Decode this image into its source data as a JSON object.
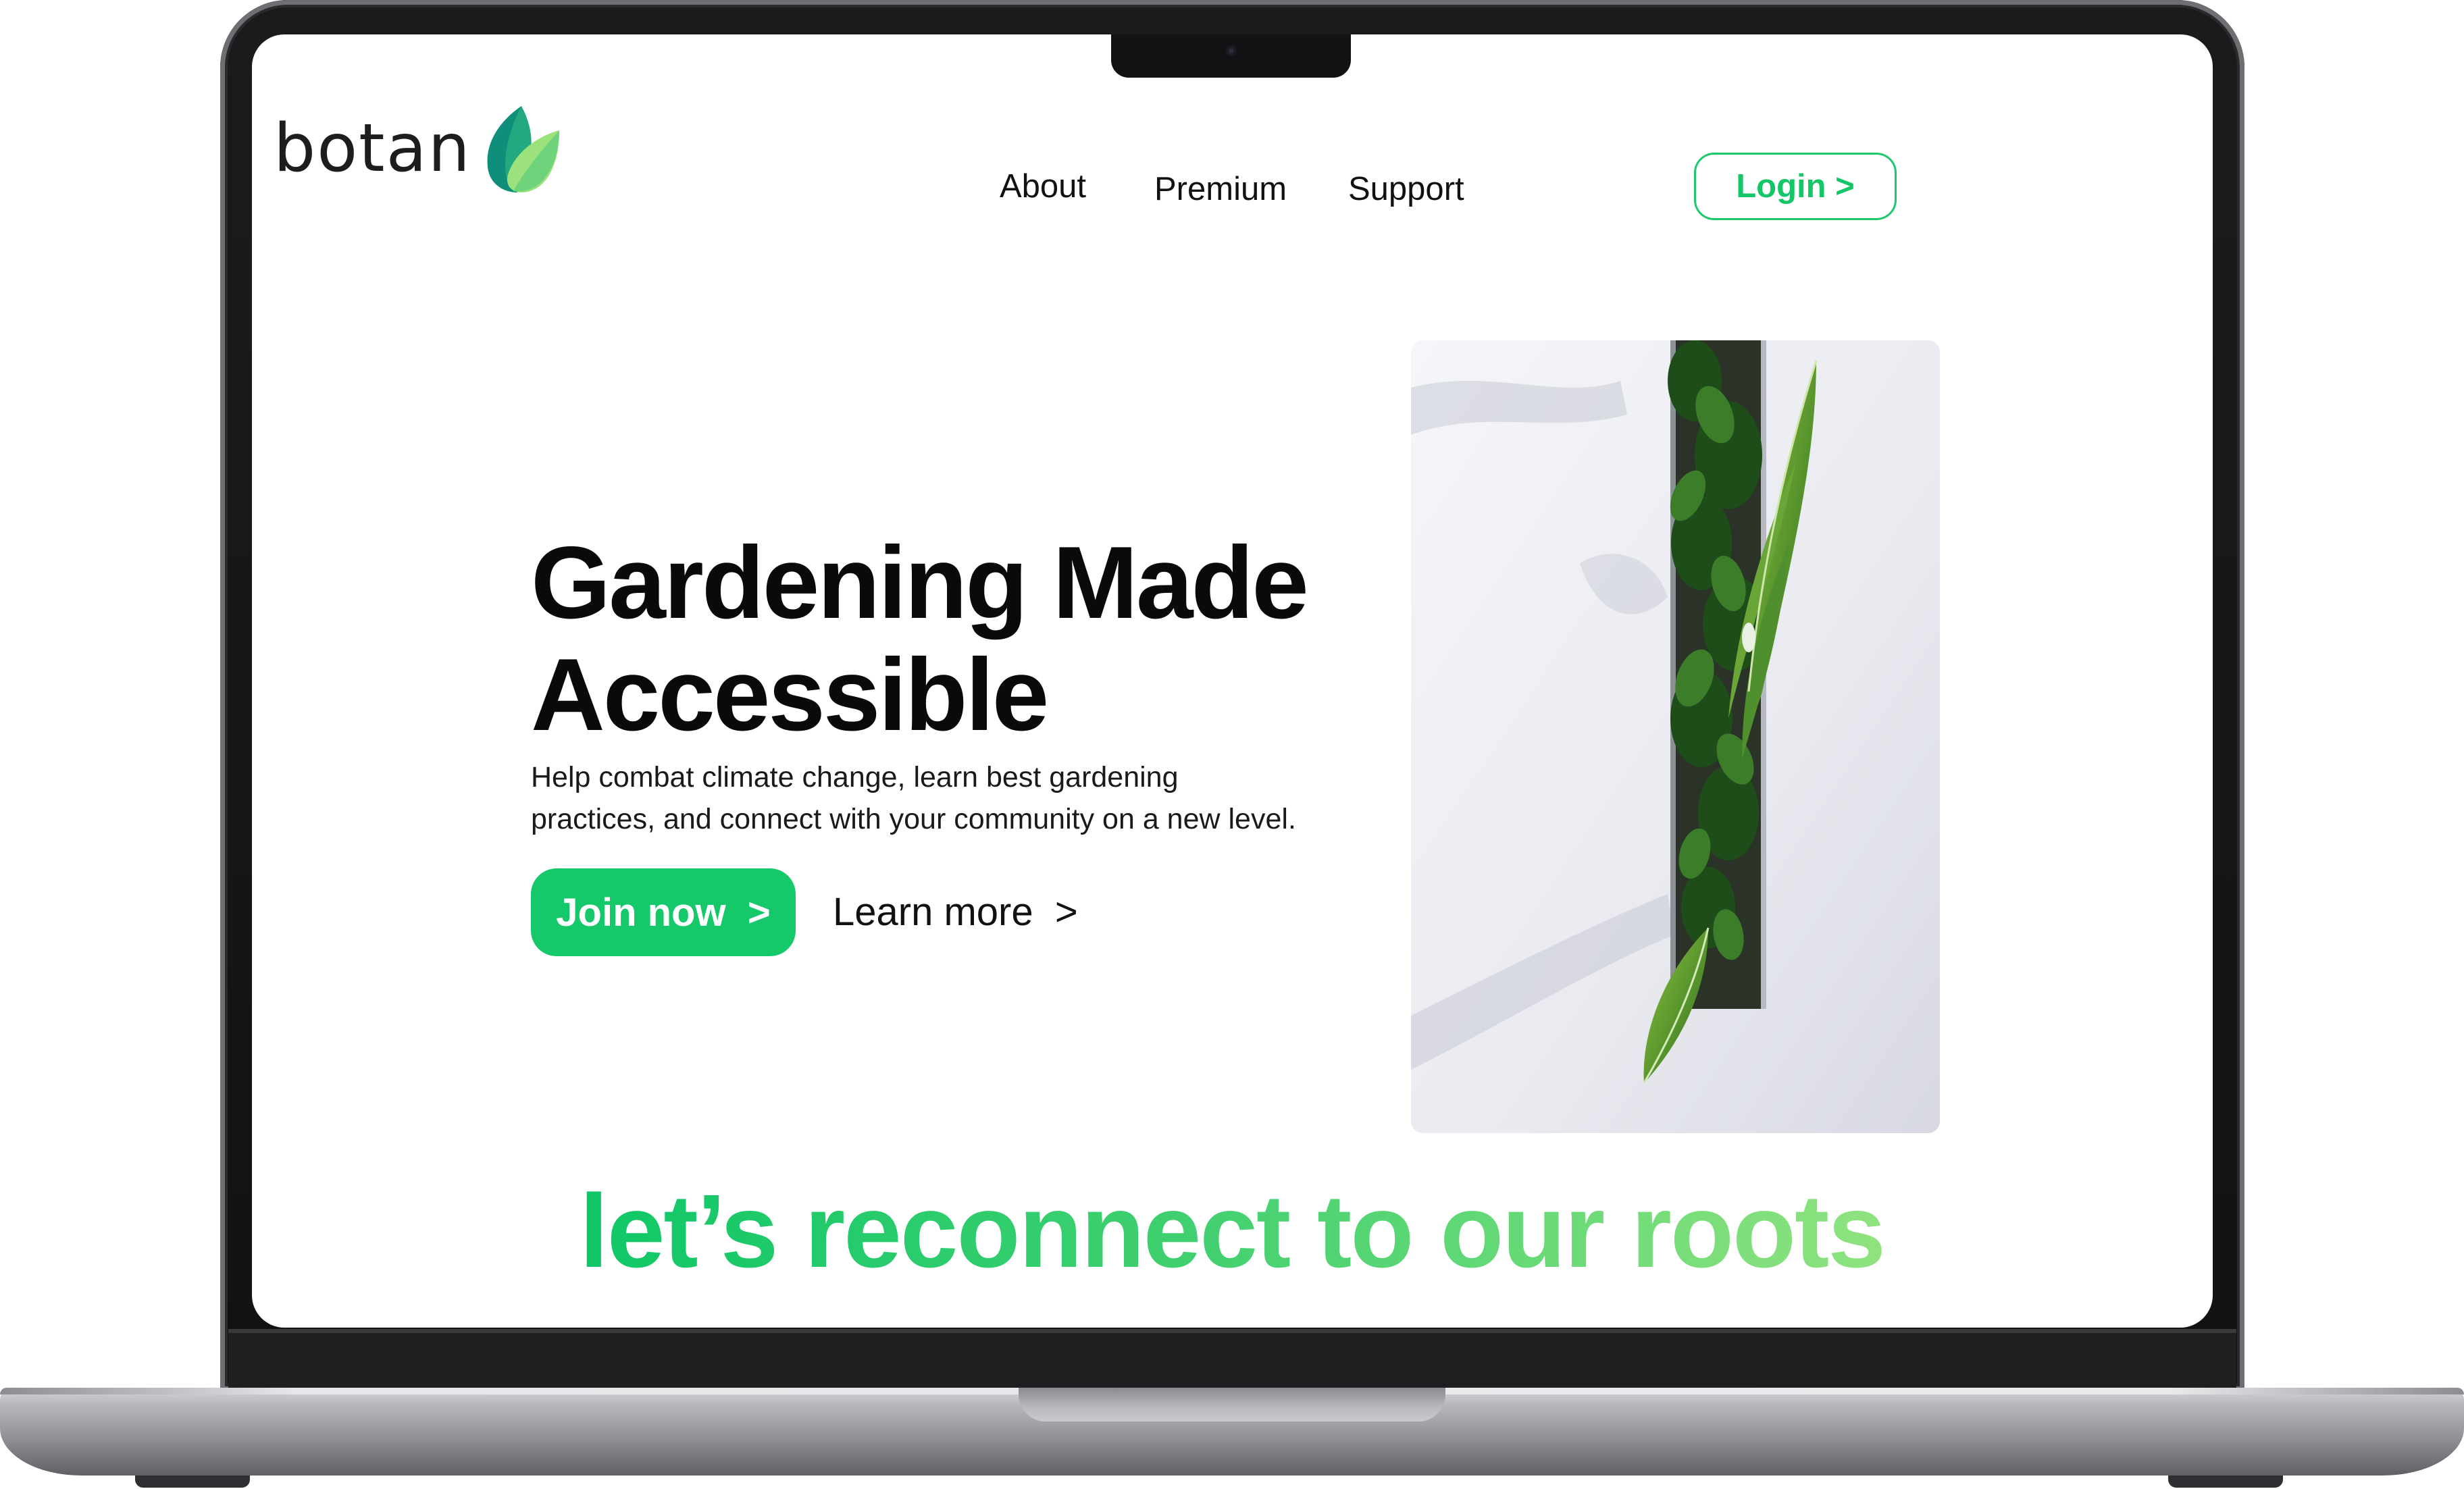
{
  "brand": {
    "name": "botan",
    "leaf_icon": "leaf-icon",
    "leaf_colors": [
      "#0f8f7a",
      "#34c38a",
      "#9be27d"
    ]
  },
  "nav": {
    "links": [
      "About",
      "Premium",
      "Support"
    ],
    "login_label": "Login >"
  },
  "hero": {
    "title_line_1": "Gardening Made",
    "title_line_2": "Accessible",
    "description_line_1": "Help combat climate change, learn best gardening",
    "description_line_2": "practices, and connect with your community on a new level.",
    "primary_cta": "Join now  >",
    "secondary_cta": "Learn more  >",
    "image": "plant-photo"
  },
  "tagline": "let’s reconnect to our roots",
  "colors": {
    "accent": "#15c86a",
    "accent_light": "#8fe37f",
    "text": "#0a0a0a"
  }
}
